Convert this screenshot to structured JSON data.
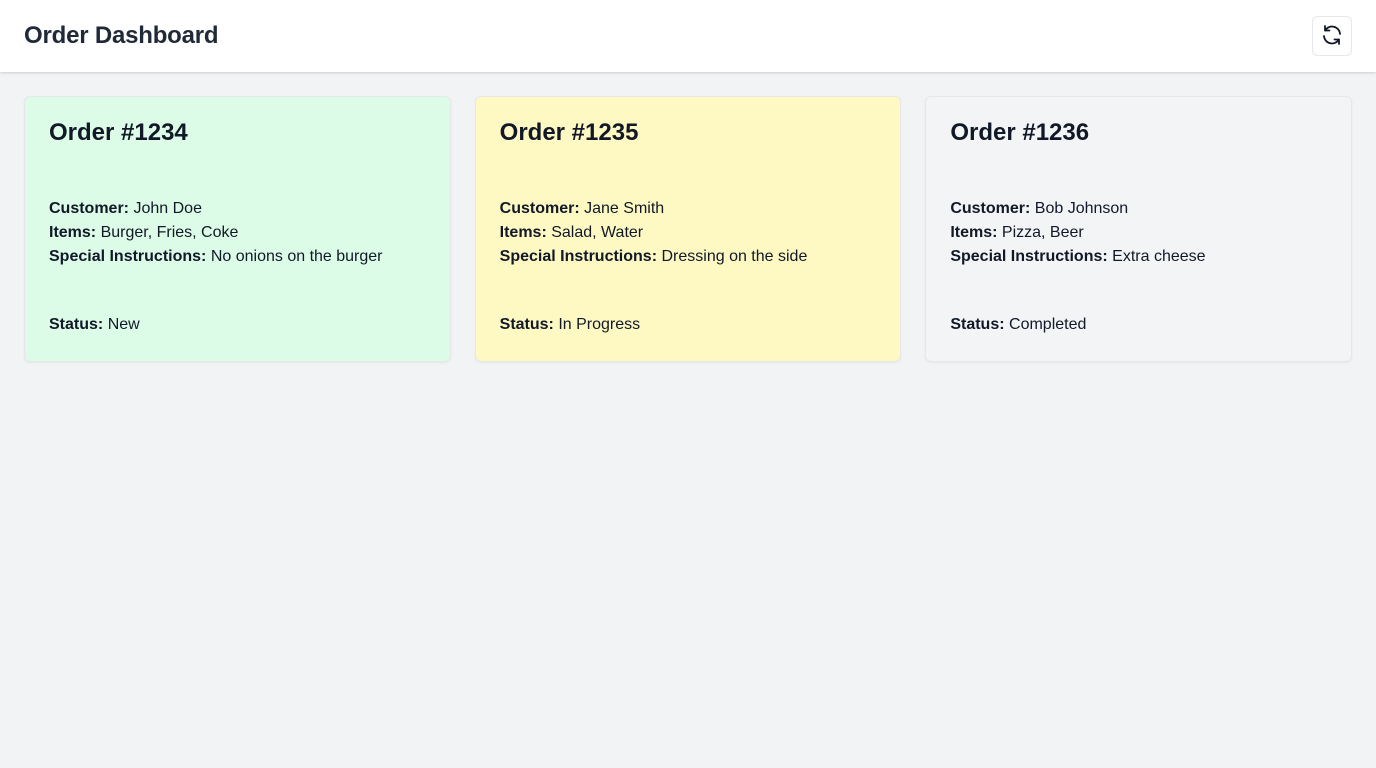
{
  "header": {
    "title": "Order Dashboard",
    "refresh_icon": "refresh-icon"
  },
  "orders": [
    {
      "title": "Order #1234",
      "customer_label": "Customer:",
      "customer": "John Doe",
      "items_label": "Items:",
      "items": "Burger, Fries, Coke",
      "instructions_label": "Special Instructions:",
      "instructions": "No onions on the burger",
      "status_label": "Status:",
      "status": "New",
      "color": "#dcfce7"
    },
    {
      "title": "Order #1235",
      "customer_label": "Customer:",
      "customer": "Jane Smith",
      "items_label": "Items:",
      "items": "Salad, Water",
      "instructions_label": "Special Instructions:",
      "instructions": "Dressing on the side",
      "status_label": "Status:",
      "status": "In Progress",
      "color": "#fef9c3"
    },
    {
      "title": "Order #1236",
      "customer_label": "Customer:",
      "customer": "Bob Johnson",
      "items_label": "Items:",
      "items": "Pizza, Beer",
      "instructions_label": "Special Instructions:",
      "instructions": "Extra cheese",
      "status_label": "Status:",
      "status": "Completed",
      "color": "#f3f4f6"
    }
  ]
}
